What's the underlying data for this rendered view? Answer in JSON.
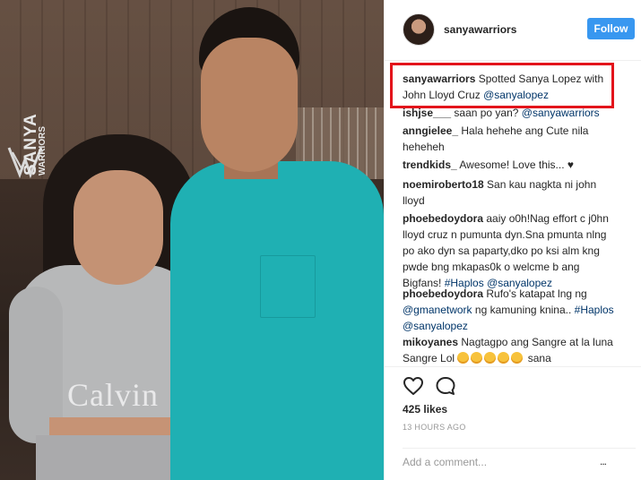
{
  "post": {
    "watermark": {
      "title": "SANYA",
      "subtitle": "WARRIORS"
    },
    "shirt_text": "Calvin"
  },
  "header": {
    "username": "sanyawarriors",
    "follow_label": "Follow"
  },
  "caption": {
    "user": "sanyawarriors",
    "text": "Spotted Sanya Lopez with John Lloyd Cruz",
    "tag": "@sanyalopez"
  },
  "comments": [
    {
      "user": "ishjse___",
      "text": "saan po yan?",
      "tag": "@sanyawarriors"
    },
    {
      "user": "anngielee_",
      "text": "Hala hehehe ang Cute nila heheheh"
    },
    {
      "user": "trendkids_",
      "text": "Awesome! Love this... ♥"
    },
    {
      "user": "noemiroberto18",
      "text": "San kau nagkta ni john lloyd"
    },
    {
      "user": "phoebedoydora",
      "text": "aaiy o0h!Nag effort c j0hn lloyd cruz n pumunta dyn.Sna pmunta nlng po ako dyn sa paparty,dko po ksi alm kng pwde bng mkapas0k o welcme b ang Bigfans!",
      "tags": "#Haplos @sanyalopez"
    },
    {
      "user": "phoebedoydora",
      "text": "Rufo's katapat lng ng",
      "tag_start": "@gmanetwork",
      "text2": "ng kamuning knina..",
      "tags": "#Haplos @sanyalopez"
    },
    {
      "user": "mikoyanes",
      "text": "Nagtagpo ang Sangre at la luna Sangre Lol",
      "text2": "sana"
    }
  ],
  "actions": {
    "like_icon": "heart-icon",
    "comment_icon": "comment-bubble-icon",
    "likes": "425 likes",
    "timestamp": "13 HOURS AGO",
    "comment_placeholder": "Add a comment...",
    "more_label": "..."
  },
  "colors": {
    "follow_button": "#3897f0",
    "highlight_box": "#e3141b",
    "link": "#003569"
  }
}
